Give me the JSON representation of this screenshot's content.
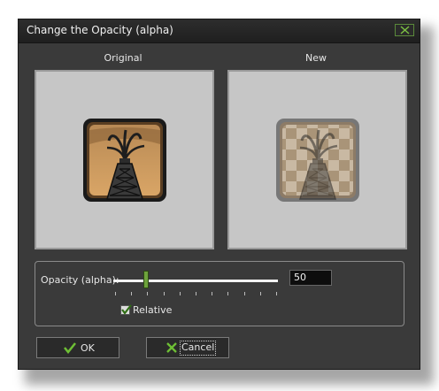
{
  "window": {
    "title": "Change the Opacity (alpha)"
  },
  "preview": {
    "original_label": "Original",
    "new_label": "New",
    "icon_name": "oil-derrick-icon",
    "icon_colors": {
      "frame_dark": "#3a2a18",
      "frame_light": "#c9965a",
      "tower": "#2b2b2b"
    }
  },
  "opacity": {
    "label": "Opacity (alpha):",
    "value": "50",
    "slider_fraction": 0.2,
    "tick_count": 11
  },
  "relative": {
    "label": "Relative",
    "checked": true
  },
  "buttons": {
    "ok_label": "OK",
    "cancel_label": "Cancel"
  },
  "colors": {
    "accent_green": "#6ea33c",
    "dialog_bg": "#3a3a3a"
  }
}
